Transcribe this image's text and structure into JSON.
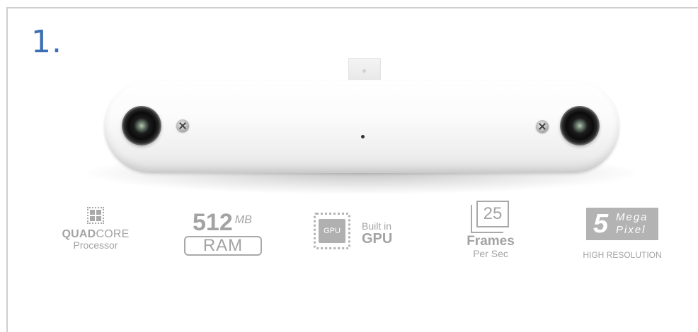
{
  "step": {
    "number": "1."
  },
  "colors": {
    "step_number": "#3a6fb3",
    "feature_gray": "#a3a3a3",
    "device_body": "#f7f7f7"
  },
  "features": {
    "quad": {
      "icon": "cpu-chip-icon",
      "bold": "QUAD",
      "rest": "CORE",
      "sub": "Processor"
    },
    "ram": {
      "amount": "512",
      "unit": "MB",
      "label": "RAM"
    },
    "gpu": {
      "icon": "gpu-chip-icon",
      "chip_label": "GPU",
      "line1": "Built in",
      "line2": "GPU"
    },
    "fps": {
      "icon": "frames-stack-icon",
      "value": "25",
      "line1": "Frames",
      "line2": "Per Sec"
    },
    "mp": {
      "value": "5",
      "line1": "Mega",
      "line2": "Pixel",
      "caption": "HIGH RESOLUTION"
    }
  }
}
